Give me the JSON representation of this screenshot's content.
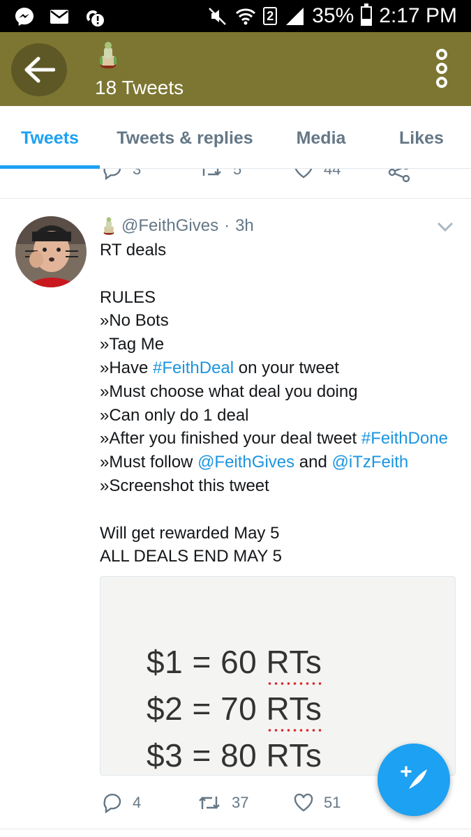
{
  "status_bar": {
    "battery": "35%",
    "battery_level": 0.35,
    "time": "2:17 PM",
    "sim_number": "2",
    "icons": [
      "messenger-icon",
      "mail-icon",
      "alert-icon",
      "mute-icon",
      "wifi-icon",
      "sim-icon",
      "signal-icon",
      "battery-icon"
    ]
  },
  "header": {
    "title": "18 Tweets",
    "color": "#7d7632"
  },
  "tabs": [
    {
      "label": "Tweets",
      "active": true
    },
    {
      "label": "Tweets & replies",
      "active": false
    },
    {
      "label": "Media",
      "active": false
    },
    {
      "label": "Likes",
      "active": false
    }
  ],
  "prev_tweet_actions": {
    "replies": "3",
    "retweets": "5",
    "likes": "44"
  },
  "tweet": {
    "handle": "@FeithGives",
    "separator": "·",
    "time": "3h",
    "text_lines": {
      "l1": "RT deals",
      "l2": "RULES",
      "l3": "»No Bots",
      "l4": "»Tag Me",
      "l5_a": "»Have ",
      "l5_link": "#FeithDeal",
      "l5_b": " on your tweet",
      "l6": "»Must choose what deal you doing",
      "l7": "»Can only do 1 deal",
      "l8_a": "»After you finished your deal tweet ",
      "l8_link": "#FeithDone",
      "l9_a": "»Must follow ",
      "l9_link1": "@FeithGives",
      "l9_b": " and ",
      "l9_link2": "@iTzFeith",
      "l10": "»Screenshot this tweet",
      "l11": "Will get rewarded May 5",
      "l12": "ALL DEALS END MAY 5"
    },
    "media": {
      "deals": [
        {
          "price": "$1 = 60 ",
          "unit": "RTs"
        },
        {
          "price": "$2 = 70 ",
          "unit": "RTs"
        },
        {
          "price": "$3 = 80 ",
          "unit": "RTs"
        }
      ]
    },
    "actions": {
      "replies": "4",
      "retweets": "37",
      "likes": "51"
    }
  },
  "colors": {
    "accent": "#1da1f2",
    "link": "#1b95e0",
    "muted": "#657786"
  }
}
